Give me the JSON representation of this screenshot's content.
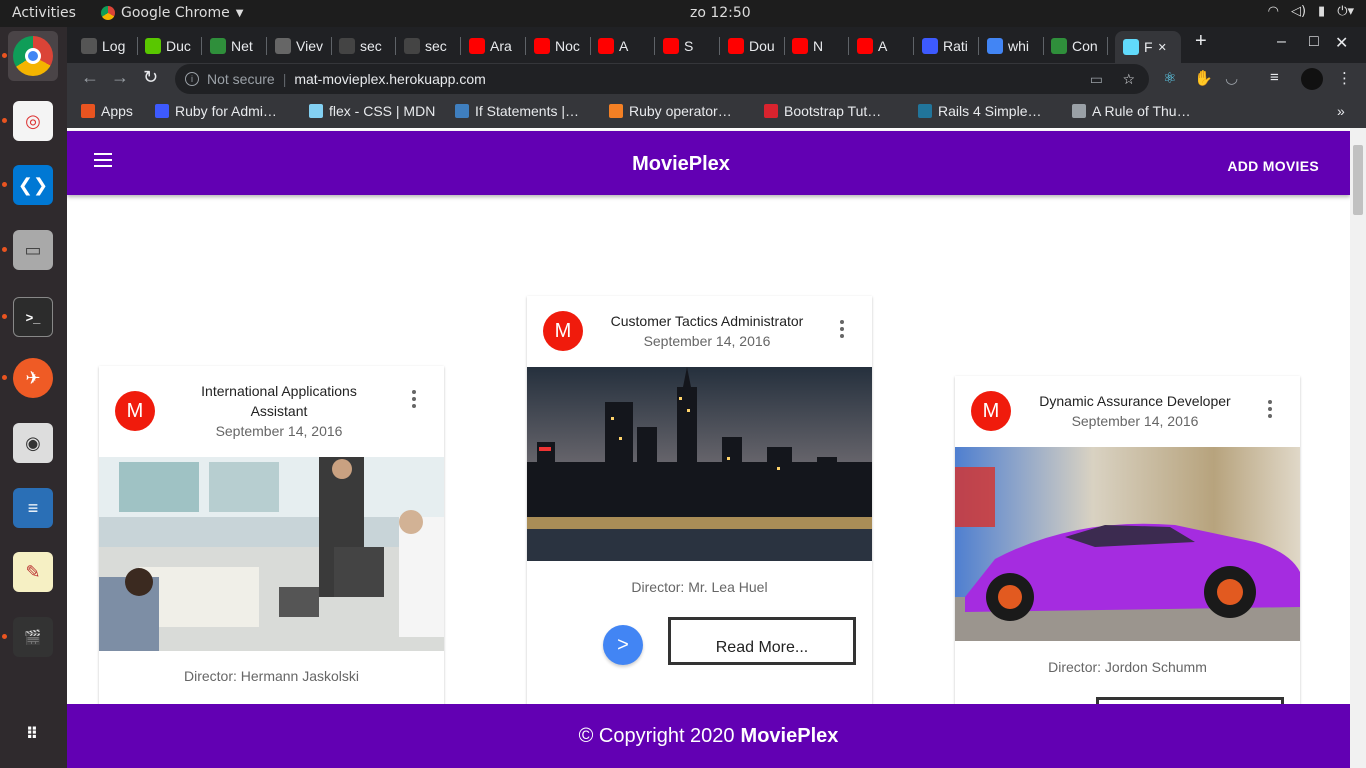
{
  "topbar": {
    "activities": "Activities",
    "app_name": "Google Chrome",
    "clock": "zo 12:50"
  },
  "dock": {
    "items": [
      {
        "name": "chrome-icon",
        "active": true
      },
      {
        "name": "document-viewer-icon"
      },
      {
        "name": "vscode-icon"
      },
      {
        "name": "files-icon"
      },
      {
        "name": "terminal-icon"
      },
      {
        "name": "postman-icon"
      },
      {
        "name": "audio-player-icon"
      },
      {
        "name": "writer-icon"
      },
      {
        "name": "text-editor-icon"
      },
      {
        "name": "video-editor-icon"
      },
      {
        "name": "show-applications-icon"
      }
    ]
  },
  "tabs": [
    {
      "label": "Log",
      "fav_color": "#555555"
    },
    {
      "label": "Duc",
      "fav_color": "#59c700"
    },
    {
      "label": "Net",
      "fav_color": "#2f8f3b"
    },
    {
      "label": "Viev",
      "fav_color": "#666666"
    },
    {
      "label": "sec",
      "fav_color": "#444444"
    },
    {
      "label": "sec",
      "fav_color": "#444444"
    },
    {
      "label": "Ara",
      "fav_color": "#ff0000"
    },
    {
      "label": "Noc",
      "fav_color": "#ff0000"
    },
    {
      "label": "A",
      "fav_color": "#ff0000"
    },
    {
      "label": "S",
      "fav_color": "#ff0000"
    },
    {
      "label": "Dou",
      "fav_color": "#ff0000"
    },
    {
      "label": "N",
      "fav_color": "#ff0000"
    },
    {
      "label": "A",
      "fav_color": "#ff0000"
    },
    {
      "label": "Rati",
      "fav_color": "#3d5afe"
    },
    {
      "label": "whi",
      "fav_color": "#4285f4"
    },
    {
      "label": "Con",
      "fav_color": "#2f8f3b"
    },
    {
      "label": "F",
      "fav_color": "#61dafb",
      "active": true
    }
  ],
  "toolbar": {
    "security": "Not secure",
    "url": "mat-movieplex.herokuapp.com"
  },
  "bookmarks": [
    {
      "label": "Apps",
      "fav_color": "#e95420"
    },
    {
      "label": "Ruby for Admi…",
      "fav_color": "#3d5afe"
    },
    {
      "label": "flex - CSS | MDN",
      "fav_color": "#83d0f2"
    },
    {
      "label": "If Statements |…",
      "fav_color": "#3f7fbf"
    },
    {
      "label": "Ruby operator…",
      "fav_color": "#f48024"
    },
    {
      "label": "Bootstrap Tut…",
      "fav_color": "#d9232e"
    },
    {
      "label": "Rails 4 Simple…",
      "fav_color": "#21759b"
    },
    {
      "label": "A Rule of Thu…",
      "fav_color": "#9aa0a6"
    }
  ],
  "app": {
    "brand": "MoviePlex",
    "add_movies": "ADD MOVIES"
  },
  "cards": [
    {
      "avatar": "M",
      "title": "International Applications Assistant",
      "date": "September 14, 2016",
      "director": "Director: Hermann Jaskolski",
      "image": "office-photo"
    },
    {
      "avatar": "M",
      "title": "Customer Tactics Administrator",
      "date": "September 14, 2016",
      "director": "Director: Mr. Lea Huel",
      "image": "city-skyline-photo",
      "go_label": ">",
      "read_more": "Read More..."
    },
    {
      "avatar": "M",
      "title": "Dynamic Assurance Developer",
      "date": "September 14, 2016",
      "director": "Director: Jordon Schumm",
      "image": "purple-car-photo"
    }
  ],
  "footer": {
    "copyright": "© Copyright 2020",
    "brand": "MoviePlex"
  }
}
